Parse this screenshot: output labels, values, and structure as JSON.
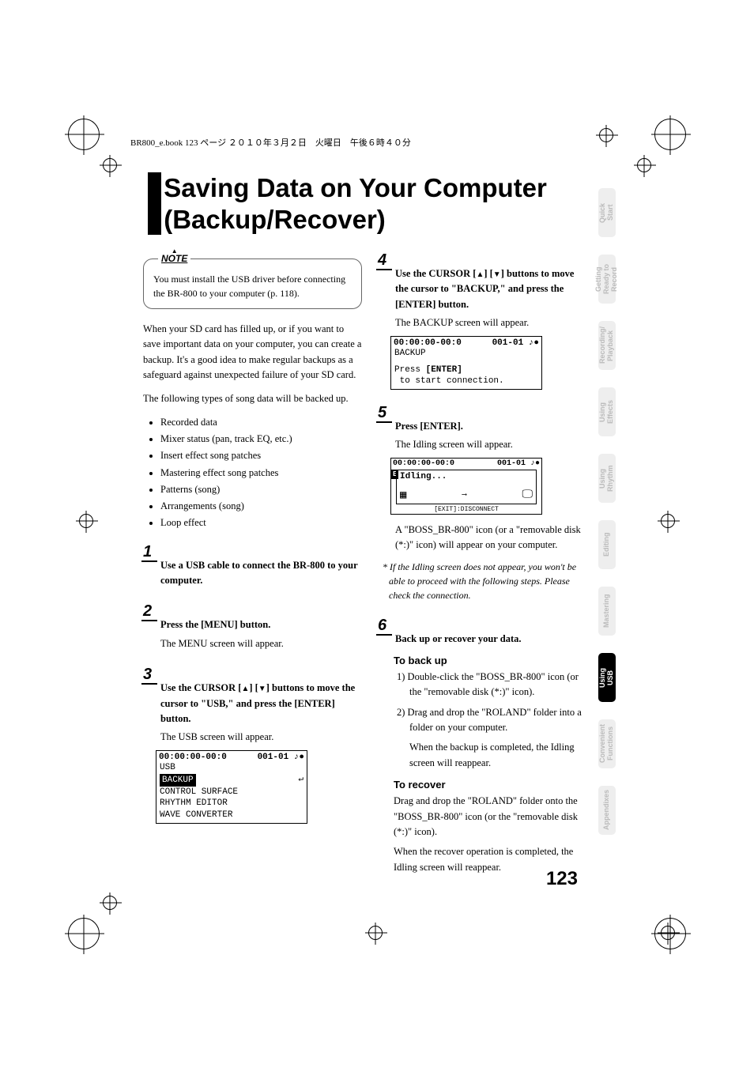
{
  "header": "BR800_e.book 123 ページ ２０１０年３月２日　火曜日　午後６時４０分",
  "title": "Saving Data on Your Computer (Backup/Recover)",
  "note": {
    "label": "NOTE",
    "text": "You must install the USB driver before connecting the BR-800 to your computer (p. 118)."
  },
  "intro": "When your SD card has filled up, or if you want to save important data on your computer, you can create a backup. It's a good idea to make regular backups as a safeguard against unexpected failure of your SD card.",
  "backup_intro": "The following types of song data will be backed up.",
  "bullets": [
    "Recorded data",
    "Mixer status (pan, track EQ, etc.)",
    "Insert effect song patches",
    "Mastering effect song patches",
    "Patterns (song)",
    "Arrangements (song)",
    "Loop effect"
  ],
  "steps": {
    "s1": {
      "num": "1",
      "text": "Use a USB cable to connect the BR-800 to your computer."
    },
    "s2": {
      "num": "2",
      "text": "Press the [MENU] button.",
      "sub": "The MENU screen will appear."
    },
    "s3": {
      "num": "3",
      "text_a": "Use the CURSOR [",
      "text_b": "] [",
      "text_c": "] buttons to move the cursor to \"USB,\" and press the [ENTER] button.",
      "sub": "The USB screen will appear.",
      "lcd": {
        "time": "00:00:00-00:0",
        "pos": "001-01",
        "title": "USB",
        "items": [
          "BACKUP",
          "CONTROL SURFACE",
          "RHYTHM EDITOR",
          "WAVE CONVERTER"
        ]
      }
    },
    "s4": {
      "num": "4",
      "text_a": "Use the CURSOR [",
      "text_b": "] [",
      "text_c": "] buttons to move the cursor to \"BACKUP,\" and press the [ENTER] button.",
      "sub": "The BACKUP screen will appear.",
      "lcd": {
        "time": "00:00:00-00:0",
        "pos": "001-01",
        "title": "BACKUP",
        "line1": "Press [ENTER]",
        "line2": " to start connection."
      }
    },
    "s5": {
      "num": "5",
      "text": "Press [ENTER].",
      "sub": "The Idling screen will appear.",
      "lcd": {
        "time": "00:00:00-00:0",
        "pos": "001-01",
        "idling": "Idling...",
        "bottom": "[EXIT]:DISCONNECT"
      },
      "after": "A \"BOSS_BR-800\" icon (or a \"removable disk (*:)\" icon) will appear on your computer.",
      "note": "* If the Idling screen does not appear, you won't be able to proceed with the following steps. Please check the connection."
    },
    "s6": {
      "num": "6",
      "text": "Back up or recover your data.",
      "backup_h": "To back up",
      "b1": "1) Double-click the \"BOSS_BR-800\" icon (or the \"removable disk (*:)\" icon).",
      "b2": "2) Drag and drop the \"ROLAND\" folder into a folder on your computer.",
      "b_after": "When the backup is completed, the Idling screen will reappear.",
      "recover_h": "To recover",
      "r1": "Drag and drop the \"ROLAND\" folder onto the \"BOSS_BR-800\" icon (or the \"removable disk (*:)\" icon).",
      "r_after": "When the recover operation is completed, the Idling screen will reappear."
    }
  },
  "tabs": [
    {
      "label": "Quick Start",
      "active": false
    },
    {
      "label": "Getting Ready to Record",
      "active": false
    },
    {
      "label": "Recording/ Playback",
      "active": false
    },
    {
      "label": "Using Effects",
      "active": false
    },
    {
      "label": "Using Rhythm",
      "active": false
    },
    {
      "label": "Editing",
      "active": false
    },
    {
      "label": "Mastering",
      "active": false
    },
    {
      "label": "Using USB",
      "active": true
    },
    {
      "label": "Convenient Functions",
      "active": false
    },
    {
      "label": "Appendixes",
      "active": false
    }
  ],
  "page_number": "123"
}
